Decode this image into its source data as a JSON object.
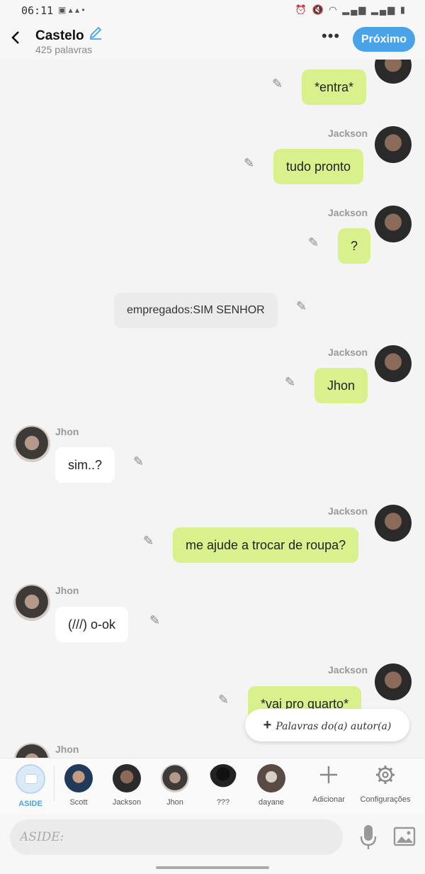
{
  "status_bar": {
    "time": "06:11"
  },
  "header": {
    "title": "Castelo",
    "word_count": "425 palavras",
    "next_label": "Próximo"
  },
  "messages": [
    {
      "sender": "",
      "text": "*entra*",
      "side": "right"
    },
    {
      "sender": "Jackson",
      "text": "tudo pronto",
      "side": "right"
    },
    {
      "sender": "Jackson",
      "text": "?",
      "side": "right"
    },
    {
      "sender": "",
      "text": "empregados:SIM SENHOR",
      "side": "aside"
    },
    {
      "sender": "Jackson",
      "text": "Jhon",
      "side": "right"
    },
    {
      "sender": "Jhon",
      "text": "sim..?",
      "side": "left"
    },
    {
      "sender": "Jackson",
      "text": "me ajude a trocar de roupa?",
      "side": "right"
    },
    {
      "sender": "Jhon",
      "text": "(///) o-ok",
      "side": "left"
    },
    {
      "sender": "Jackson",
      "text": "*vai pro quarto*",
      "side": "right"
    },
    {
      "sender": "Jhon",
      "text": "",
      "side": "left"
    }
  ],
  "author_words_button": "Palavras do(a) autor(a)",
  "characters": [
    {
      "label": "ASIDE"
    },
    {
      "label": "Scott"
    },
    {
      "label": "Jackson"
    },
    {
      "label": "Jhon"
    },
    {
      "label": "???"
    },
    {
      "label": "dayane"
    }
  ],
  "tools": {
    "add_label": "Adicionar",
    "settings_label": "Configurações"
  },
  "composer": {
    "placeholder": "ASIDE:"
  }
}
